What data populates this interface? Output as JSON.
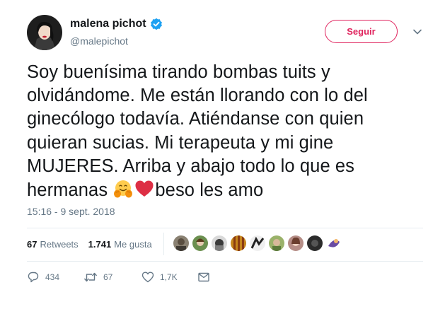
{
  "user": {
    "display_name": "malena pichot",
    "username": "@malepichot",
    "verified": true
  },
  "follow_button": {
    "label": "Seguir"
  },
  "tweet": {
    "lines": [
      "Soy buenísima tirando bombas tuits y",
      "olvidándome. Me están llorando con lo del",
      "ginecólogo todavía. Atiéndanse con quien",
      "quieran sucias. Mi terapeuta y mi gine",
      "MUJERES. Arriba y abajo todo lo que es"
    ],
    "last_line_start": "hermanas ",
    "last_line_end": "beso les amo",
    "emojis": [
      "hugging-face",
      "red-heart"
    ]
  },
  "timestamp": "15:16 - 9 sept. 2018",
  "stats": {
    "retweets_count": "67",
    "retweets_label": "Retweets",
    "likes_count": "1.741",
    "likes_label": "Me gusta"
  },
  "actions": {
    "replies": "434",
    "retweets": "67",
    "likes": "1,7K"
  },
  "colors": {
    "accent": "#e0245e",
    "verified": "#1da1f2",
    "muted": "#657786"
  }
}
